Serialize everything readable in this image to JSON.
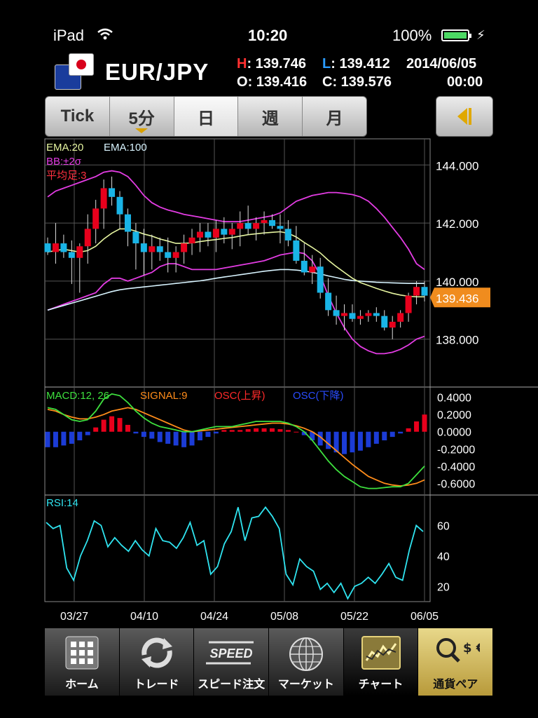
{
  "status_bar": {
    "device": "iPad",
    "time": "10:20",
    "battery": "100%"
  },
  "header": {
    "pair": "EUR/JPY",
    "high_label": "H",
    "high": "139.746",
    "low_label": "L",
    "low": "139.412",
    "date": "2014/06/05",
    "open_label": "O",
    "open": "139.416",
    "close_label": "C",
    "close": "139.576",
    "time": "00:00"
  },
  "tabs": [
    {
      "label": "Tick"
    },
    {
      "label": "5分"
    },
    {
      "label": "日"
    },
    {
      "label": "週"
    },
    {
      "label": "月"
    }
  ],
  "colors": {
    "up": "#e8001c",
    "down": "#19b4e6",
    "ema20": "#e6f5a0",
    "ema100": "#d8f4ff",
    "bb": "#e33ce3",
    "macd": "#3ee03e",
    "signal": "#ff8c1a",
    "rsi": "#2fe4f0",
    "price_tag": "#f08c1e"
  },
  "chart_data": [
    {
      "type": "candlestick",
      "legend": [
        "EMA:20",
        "EMA:100",
        "BB:±2σ",
        "平均足:3"
      ],
      "y_ticks": [
        "144.000",
        "142.000",
        "140.000",
        "138.000"
      ],
      "ylim": [
        136.4,
        144.9
      ],
      "current_price": "139.436",
      "x_ticks": [
        "03/27",
        "04/10",
        "04/24",
        "05/08",
        "05/22",
        "06/05"
      ],
      "candles": [
        [
          141.3,
          141.5,
          140.9,
          141.0
        ],
        [
          141.0,
          142.0,
          140.6,
          141.3
        ],
        [
          141.3,
          141.6,
          140.8,
          141.0
        ],
        [
          141.0,
          141.4,
          139.9,
          140.8
        ],
        [
          140.8,
          141.3,
          139.6,
          141.2
        ],
        [
          141.2,
          142.3,
          140.6,
          141.8
        ],
        [
          141.8,
          142.8,
          141.3,
          142.5
        ],
        [
          142.5,
          143.5,
          141.8,
          143.2
        ],
        [
          143.2,
          143.6,
          142.6,
          142.9
        ],
        [
          142.9,
          143.1,
          141.8,
          142.3
        ],
        [
          142.3,
          142.5,
          141.2,
          141.7
        ],
        [
          141.7,
          142.0,
          140.4,
          141.3
        ],
        [
          141.3,
          141.8,
          140.2,
          141.0
        ],
        [
          141.0,
          141.6,
          140.4,
          141.2
        ],
        [
          141.2,
          141.5,
          140.7,
          141.0
        ],
        [
          141.0,
          141.5,
          140.3,
          140.8
        ],
        [
          140.8,
          141.2,
          140.3,
          141.0
        ],
        [
          141.0,
          141.6,
          140.6,
          141.3
        ],
        [
          141.3,
          141.8,
          140.9,
          141.5
        ],
        [
          141.5,
          142.0,
          141.0,
          141.7
        ],
        [
          141.7,
          142.0,
          141.2,
          141.5
        ],
        [
          141.5,
          142.1,
          141.0,
          141.8
        ],
        [
          141.8,
          142.2,
          141.3,
          141.6
        ],
        [
          141.6,
          142.0,
          141.1,
          141.8
        ],
        [
          141.8,
          142.4,
          141.2,
          142.0
        ],
        [
          142.0,
          142.6,
          141.6,
          141.8
        ],
        [
          141.8,
          142.2,
          141.4,
          142.0
        ],
        [
          142.0,
          142.4,
          141.6,
          142.1
        ],
        [
          142.1,
          142.3,
          141.8,
          141.9
        ],
        [
          141.9,
          142.3,
          141.3,
          141.8
        ],
        [
          141.8,
          142.1,
          141.2,
          141.4
        ],
        [
          141.4,
          141.9,
          140.6,
          140.7
        ],
        [
          140.7,
          141.3,
          140.2,
          140.3
        ],
        [
          140.3,
          140.9,
          139.9,
          140.5
        ],
        [
          140.5,
          140.8,
          139.4,
          139.6
        ],
        [
          139.6,
          140.1,
          138.8,
          139.0
        ],
        [
          139.0,
          139.5,
          138.5,
          138.8
        ],
        [
          138.8,
          139.2,
          138.3,
          138.9
        ],
        [
          138.9,
          139.2,
          138.6,
          138.7
        ],
        [
          138.7,
          139.0,
          138.5,
          138.8
        ],
        [
          138.8,
          139.0,
          138.6,
          138.9
        ],
        [
          138.9,
          139.1,
          138.6,
          138.8
        ],
        [
          138.8,
          139.0,
          138.3,
          138.4
        ],
        [
          138.4,
          138.8,
          138.0,
          138.6
        ],
        [
          138.6,
          139.0,
          138.4,
          138.9
        ],
        [
          138.9,
          139.6,
          138.6,
          139.5
        ],
        [
          139.5,
          140.0,
          139.2,
          139.8
        ],
        [
          139.8,
          140.0,
          139.3,
          139.5
        ]
      ],
      "ema20": [
        141.0,
        141.05,
        141.1,
        141.05,
        141.0,
        141.05,
        141.2,
        141.45,
        141.65,
        141.8,
        141.8,
        141.72,
        141.62,
        141.55,
        141.45,
        141.38,
        141.3,
        141.3,
        141.32,
        141.36,
        141.4,
        141.43,
        141.47,
        141.5,
        141.55,
        141.6,
        141.63,
        141.66,
        141.68,
        141.7,
        141.65,
        141.52,
        141.33,
        141.16,
        140.97,
        140.72,
        140.5,
        140.3,
        140.1,
        139.95,
        139.85,
        139.75,
        139.66,
        139.58,
        139.52,
        139.48,
        139.46,
        139.46
      ],
      "ema100": [
        139.0,
        139.08,
        139.16,
        139.24,
        139.32,
        139.4,
        139.48,
        139.56,
        139.64,
        139.7,
        139.74,
        139.77,
        139.8,
        139.83,
        139.86,
        139.89,
        139.92,
        139.95,
        139.98,
        140.01,
        140.05,
        140.1,
        140.14,
        140.18,
        140.22,
        140.26,
        140.3,
        140.34,
        140.37,
        140.4,
        140.4,
        140.38,
        140.35,
        140.3,
        140.25,
        140.18,
        140.12,
        140.06,
        140.02,
        140.0,
        139.98,
        139.96,
        139.95,
        139.94,
        139.93,
        139.92,
        139.92,
        139.92
      ],
      "bb_upper": [
        142.9,
        143.1,
        143.2,
        143.3,
        143.4,
        143.5,
        143.6,
        143.75,
        143.8,
        143.75,
        143.6,
        143.3,
        142.95,
        142.7,
        142.55,
        142.45,
        142.38,
        142.3,
        142.25,
        142.2,
        142.15,
        142.1,
        142.05,
        142.05,
        142.05,
        142.1,
        142.15,
        142.2,
        142.25,
        142.35,
        142.55,
        142.75,
        142.85,
        142.95,
        143.0,
        143.05,
        143.05,
        143.02,
        142.98,
        142.9,
        142.75,
        142.5,
        142.2,
        141.85,
        141.5,
        141.1,
        140.6,
        140.4
      ],
      "bb_lower": [
        139.0,
        139.1,
        139.2,
        139.3,
        139.4,
        139.5,
        139.6,
        139.9,
        140.1,
        140.1,
        140.0,
        140.1,
        140.2,
        140.3,
        140.5,
        140.6,
        140.6,
        140.5,
        140.4,
        140.4,
        140.4,
        140.4,
        140.45,
        140.5,
        140.55,
        140.6,
        140.65,
        140.7,
        140.8,
        140.9,
        140.95,
        141.0,
        140.95,
        140.7,
        140.2,
        139.5,
        138.9,
        138.4,
        138.0,
        137.75,
        137.6,
        137.5,
        137.5,
        137.55,
        137.65,
        137.8,
        138.0,
        138.1
      ]
    },
    {
      "type": "macd",
      "legend": [
        "MACD:12, 26",
        "SIGNAL:9",
        "OSC(上昇)",
        "OSC(下降)"
      ],
      "y_ticks": [
        "0.4000",
        "0.2000",
        "0.0000",
        "-0.2000",
        "-0.4000",
        "-0.6000"
      ],
      "ylim": [
        -0.72,
        0.52
      ],
      "macd": [
        0.28,
        0.26,
        0.2,
        0.14,
        0.12,
        0.14,
        0.24,
        0.38,
        0.44,
        0.42,
        0.34,
        0.24,
        0.16,
        0.1,
        0.06,
        0.04,
        0.02,
        0.0,
        0.0,
        0.02,
        0.04,
        0.06,
        0.06,
        0.06,
        0.08,
        0.1,
        0.12,
        0.12,
        0.12,
        0.12,
        0.1,
        0.06,
        0.0,
        -0.1,
        -0.22,
        -0.34,
        -0.44,
        -0.52,
        -0.58,
        -0.64,
        -0.66,
        -0.66,
        -0.65,
        -0.64,
        -0.64,
        -0.6,
        -0.5,
        -0.4
      ],
      "signal": [
        0.26,
        0.24,
        0.2,
        0.17,
        0.15,
        0.15,
        0.17,
        0.2,
        0.24,
        0.26,
        0.28,
        0.26,
        0.22,
        0.18,
        0.14,
        0.1,
        0.06,
        0.02,
        0.0,
        0.01,
        0.02,
        0.03,
        0.04,
        0.05,
        0.06,
        0.07,
        0.08,
        0.09,
        0.1,
        0.1,
        0.09,
        0.07,
        0.04,
        0.0,
        -0.06,
        -0.14,
        -0.22,
        -0.3,
        -0.38,
        -0.45,
        -0.52,
        -0.56,
        -0.6,
        -0.62,
        -0.63,
        -0.62,
        -0.6,
        -0.56
      ],
      "osc": [
        -0.18,
        -0.18,
        -0.16,
        -0.14,
        -0.1,
        -0.04,
        0.05,
        0.14,
        0.18,
        0.16,
        0.08,
        -0.02,
        -0.06,
        -0.08,
        -0.12,
        -0.14,
        -0.16,
        -0.18,
        -0.16,
        -0.1,
        -0.06,
        -0.02,
        0.02,
        0.02,
        0.02,
        0.03,
        0.04,
        0.04,
        0.04,
        0.03,
        0.02,
        0.0,
        -0.04,
        -0.1,
        -0.16,
        -0.2,
        -0.24,
        -0.26,
        -0.24,
        -0.22,
        -0.18,
        -0.14,
        -0.1,
        -0.06,
        -0.02,
        0.04,
        0.12,
        0.2
      ]
    },
    {
      "type": "line",
      "legend": [
        "RSI:14"
      ],
      "y_ticks": [
        "60",
        "40",
        "20"
      ],
      "ylim": [
        10,
        80
      ],
      "rsi": [
        62,
        58,
        60,
        32,
        24,
        40,
        50,
        63,
        60,
        46,
        52,
        47,
        43,
        50,
        44,
        40,
        58,
        50,
        49,
        45,
        52,
        62,
        47,
        50,
        28,
        33,
        48,
        56,
        72,
        50,
        65,
        66,
        72,
        66,
        58,
        28,
        21,
        38,
        33,
        30,
        18,
        22,
        16,
        22,
        12,
        20,
        22,
        26,
        22,
        28,
        35,
        26,
        24,
        44,
        60,
        56
      ]
    }
  ],
  "nav": [
    {
      "label": "ホーム",
      "icon": "home-grid-icon"
    },
    {
      "label": "トレード",
      "icon": "trade-cycle-icon"
    },
    {
      "label": "スピード注文",
      "icon": "speed-icon",
      "icon_text": "SPEED"
    },
    {
      "label": "マーケット",
      "icon": "globe-icon"
    },
    {
      "label": "チャート",
      "icon": "chart-icon"
    },
    {
      "label": "通貨ペア",
      "icon": "currency-icon",
      "icon_text": "$ € ¥"
    }
  ]
}
